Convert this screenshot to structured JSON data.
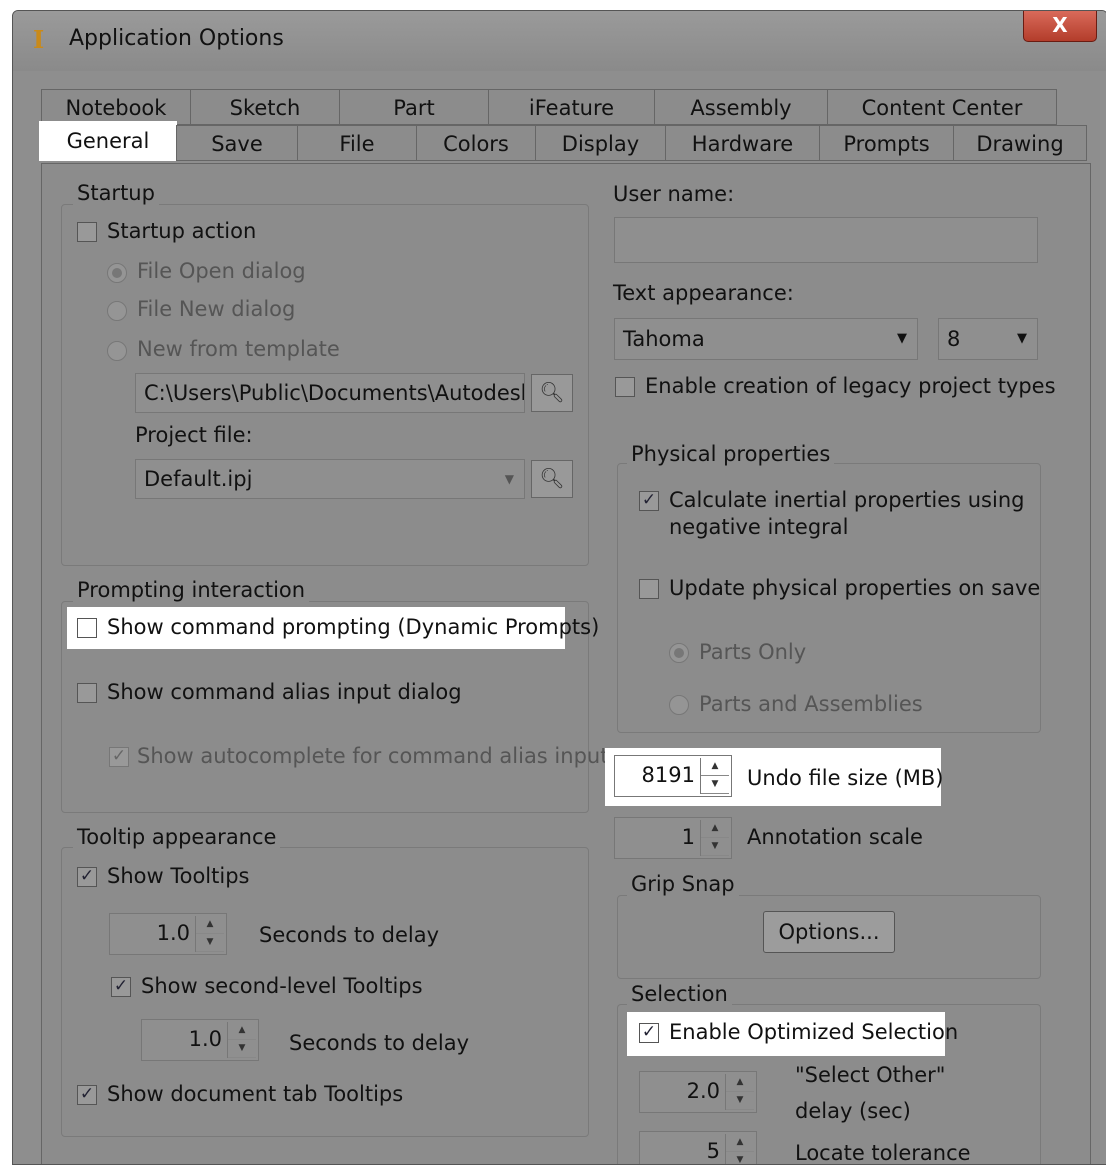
{
  "window": {
    "title": "Application Options",
    "close_label": "X"
  },
  "tabs_row1": [
    "Notebook",
    "Sketch",
    "Part",
    "iFeature",
    "Assembly",
    "Content Center"
  ],
  "tabs_row2": [
    "General",
    "Save",
    "File",
    "Colors",
    "Display",
    "Hardware",
    "Prompts",
    "Drawing"
  ],
  "startup": {
    "group_label": "Startup",
    "startup_action": "Startup action",
    "radio_open": "File Open dialog",
    "radio_new": "File New dialog",
    "radio_template": "New from template",
    "template_path": "C:\\Users\\Public\\Documents\\Autodesk\\I",
    "project_file_label": "Project file:",
    "project_file_value": "Default.ipj"
  },
  "prompting": {
    "group_label": "Prompting interaction",
    "show_command_prompting": "Show command prompting (Dynamic Prompts)",
    "show_alias_dialog": "Show command alias input dialog",
    "show_autocomplete": "Show autocomplete for command alias input"
  },
  "tooltip": {
    "group_label": "Tooltip appearance",
    "show_tooltips": "Show Tooltips",
    "delay1_value": "1.0",
    "delay1_label": "Seconds to delay",
    "show_second_level": "Show second-level Tooltips",
    "delay2_value": "1.0",
    "delay2_label": "Seconds to delay",
    "show_doc_tab": "Show document tab Tooltips"
  },
  "right": {
    "user_name_label": "User name:",
    "user_name_value": "",
    "text_appearance_label": "Text appearance:",
    "font_value": "Tahoma",
    "font_size_value": "8",
    "legacy_projects": "Enable creation of legacy project types",
    "physical_group": "Physical properties",
    "calc_inertial_line1": "Calculate inertial properties using",
    "calc_inertial_line2": "negative integral",
    "update_physical": "Update physical properties on save",
    "parts_only": "Parts Only",
    "parts_assemblies": "Parts and Assemblies",
    "undo_value": "8191",
    "undo_label": "Undo file size (MB)",
    "annotation_value": "1",
    "annotation_label": "Annotation scale",
    "grip_group": "Grip Snap",
    "options_button": "Options...",
    "selection_group": "Selection",
    "optimized_selection": "Enable Optimized Selection",
    "select_other_value": "2.0",
    "select_other_line1": "\"Select Other\"",
    "select_other_line2": "delay (sec)",
    "locate_value": "5",
    "locate_label": "Locate tolerance"
  },
  "check": "✓",
  "icons": [
    "app-icon",
    "browse-icon",
    "dropdown-arrow-icon",
    "spin-up-icon",
    "spin-down-icon"
  ]
}
